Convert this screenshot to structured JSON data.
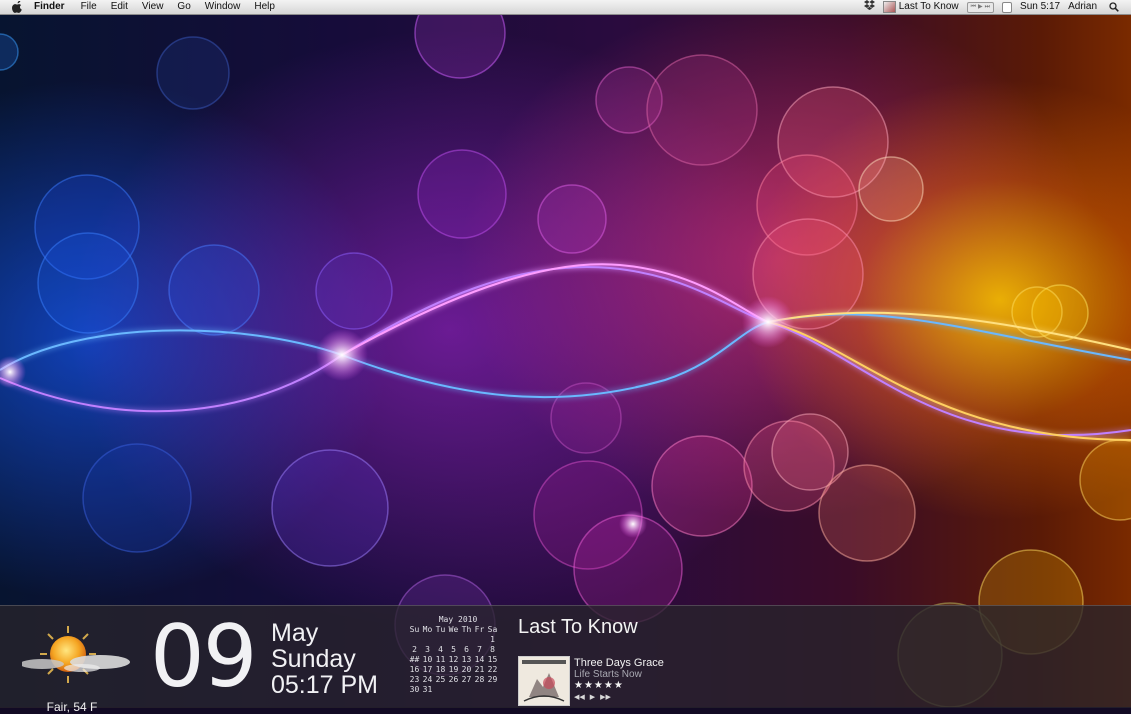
{
  "menubar": {
    "app_name": "Finder",
    "menus": [
      "File",
      "Edit",
      "View",
      "Go",
      "Window",
      "Help"
    ],
    "now_playing_track": "Last To Know",
    "clock": "Sun 5:17",
    "user": "Adrian"
  },
  "widgets": {
    "weather": {
      "label": "Fair, 54 F"
    },
    "clock": {
      "day": "09",
      "month": "May",
      "weekday": "Sunday",
      "time": "05:17 PM"
    },
    "calendar": {
      "title": "May 2010",
      "weekdays": [
        "Su",
        "Mo",
        "Tu",
        "We",
        "Th",
        "Fr",
        "Sa"
      ],
      "weeks": [
        [
          "",
          "",
          "",
          "",
          "",
          "",
          "1"
        ],
        [
          "2",
          "3",
          "4",
          "5",
          "6",
          "7",
          "8"
        ],
        [
          "##",
          "10",
          "11",
          "12",
          "13",
          "14",
          "15"
        ],
        [
          "16",
          "17",
          "18",
          "19",
          "20",
          "21",
          "22"
        ],
        [
          "23",
          "24",
          "25",
          "26",
          "27",
          "28",
          "29"
        ],
        [
          "30",
          "31",
          "",
          "",
          "",
          "",
          ""
        ]
      ]
    },
    "now_playing": {
      "title": "Last To Know",
      "artist": "Three Days Grace",
      "album": "Life Starts Now",
      "rating_text": "★★★★★",
      "rating": 5
    }
  },
  "colors": {
    "menubar_bg": "#e4e4e4",
    "widget_bar_bg": "#28242c",
    "sun": "#f5a623",
    "accent_blue": "#1e64ff",
    "accent_purple": "#b428dc",
    "accent_orange": "#ffb400"
  },
  "icons": {
    "apple": "apple-logo-icon",
    "dropbox": "dropbox-icon",
    "spotlight": "spotlight-search-icon",
    "weather": "partly-sunny-icon"
  }
}
